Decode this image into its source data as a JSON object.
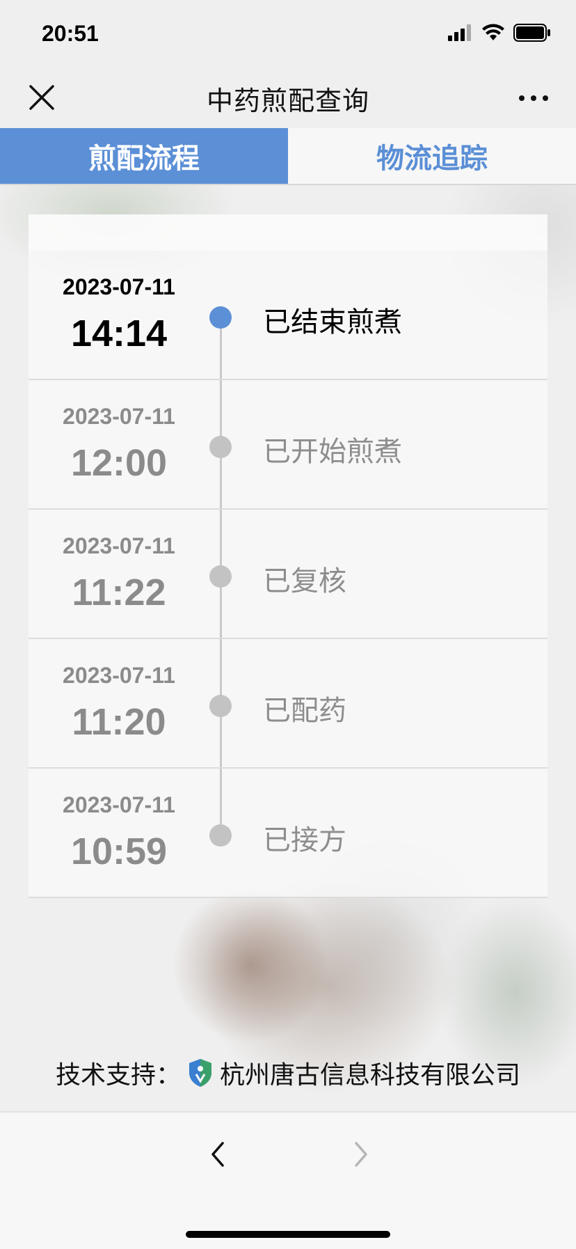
{
  "status_bar": {
    "time": "20:51"
  },
  "nav": {
    "title": "中药煎配查询"
  },
  "tabs": [
    {
      "label": "煎配流程",
      "active": true
    },
    {
      "label": "物流追踪",
      "active": false
    }
  ],
  "timeline": [
    {
      "date": "2023-07-11",
      "time": "14:14",
      "status": "已结束煎煮",
      "active": true
    },
    {
      "date": "2023-07-11",
      "time": "12:00",
      "status": "已开始煎煮",
      "active": false
    },
    {
      "date": "2023-07-11",
      "time": "11:22",
      "status": "已复核",
      "active": false
    },
    {
      "date": "2023-07-11",
      "time": "11:20",
      "status": "已配药",
      "active": false
    },
    {
      "date": "2023-07-11",
      "time": "10:59",
      "status": "已接方",
      "active": false
    }
  ],
  "footer": {
    "prefix": "技术支持：",
    "company": "杭州唐古信息科技有限公司"
  },
  "colors": {
    "accent": "#5b8fd6",
    "muted": "#8b8b8b"
  },
  "icons": [
    "close-icon",
    "more-icon",
    "signal-icon",
    "wifi-icon",
    "battery-icon",
    "back-arrow-icon",
    "forward-arrow-icon",
    "company-logo-icon"
  ]
}
